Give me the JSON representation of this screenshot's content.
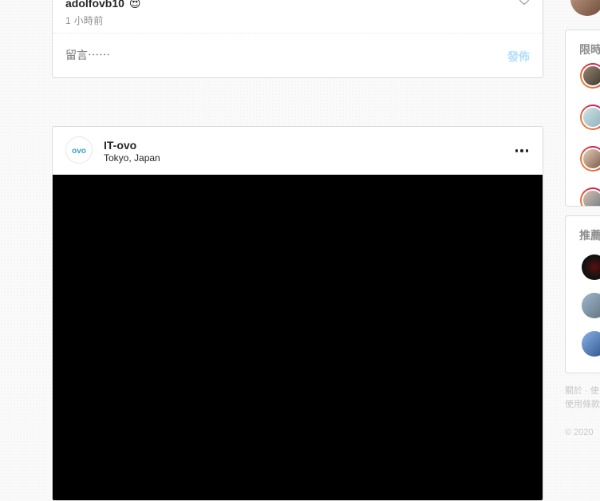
{
  "previous_post": {
    "username": "adolfovb10",
    "emoji": "😍",
    "time": "1 小時前",
    "comment_placeholder": "留言⋯⋯",
    "publish_label": "發佈"
  },
  "post": {
    "username": "IT-ovo",
    "location": "Tokyo, Japan",
    "avatar_text": "OVO"
  },
  "sidebar": {
    "stories_title": "限時",
    "suggestions_title": "推薦",
    "footer_links": "關於 · 使",
    "footer_links_2": "使用條款",
    "copyright": "© 2020"
  },
  "colors": {
    "link_blue_disabled": "#b2dffc",
    "muted_text": "#8e8e8e",
    "border": "#dbdbdb",
    "logo_blue": "#3aa0c8"
  }
}
